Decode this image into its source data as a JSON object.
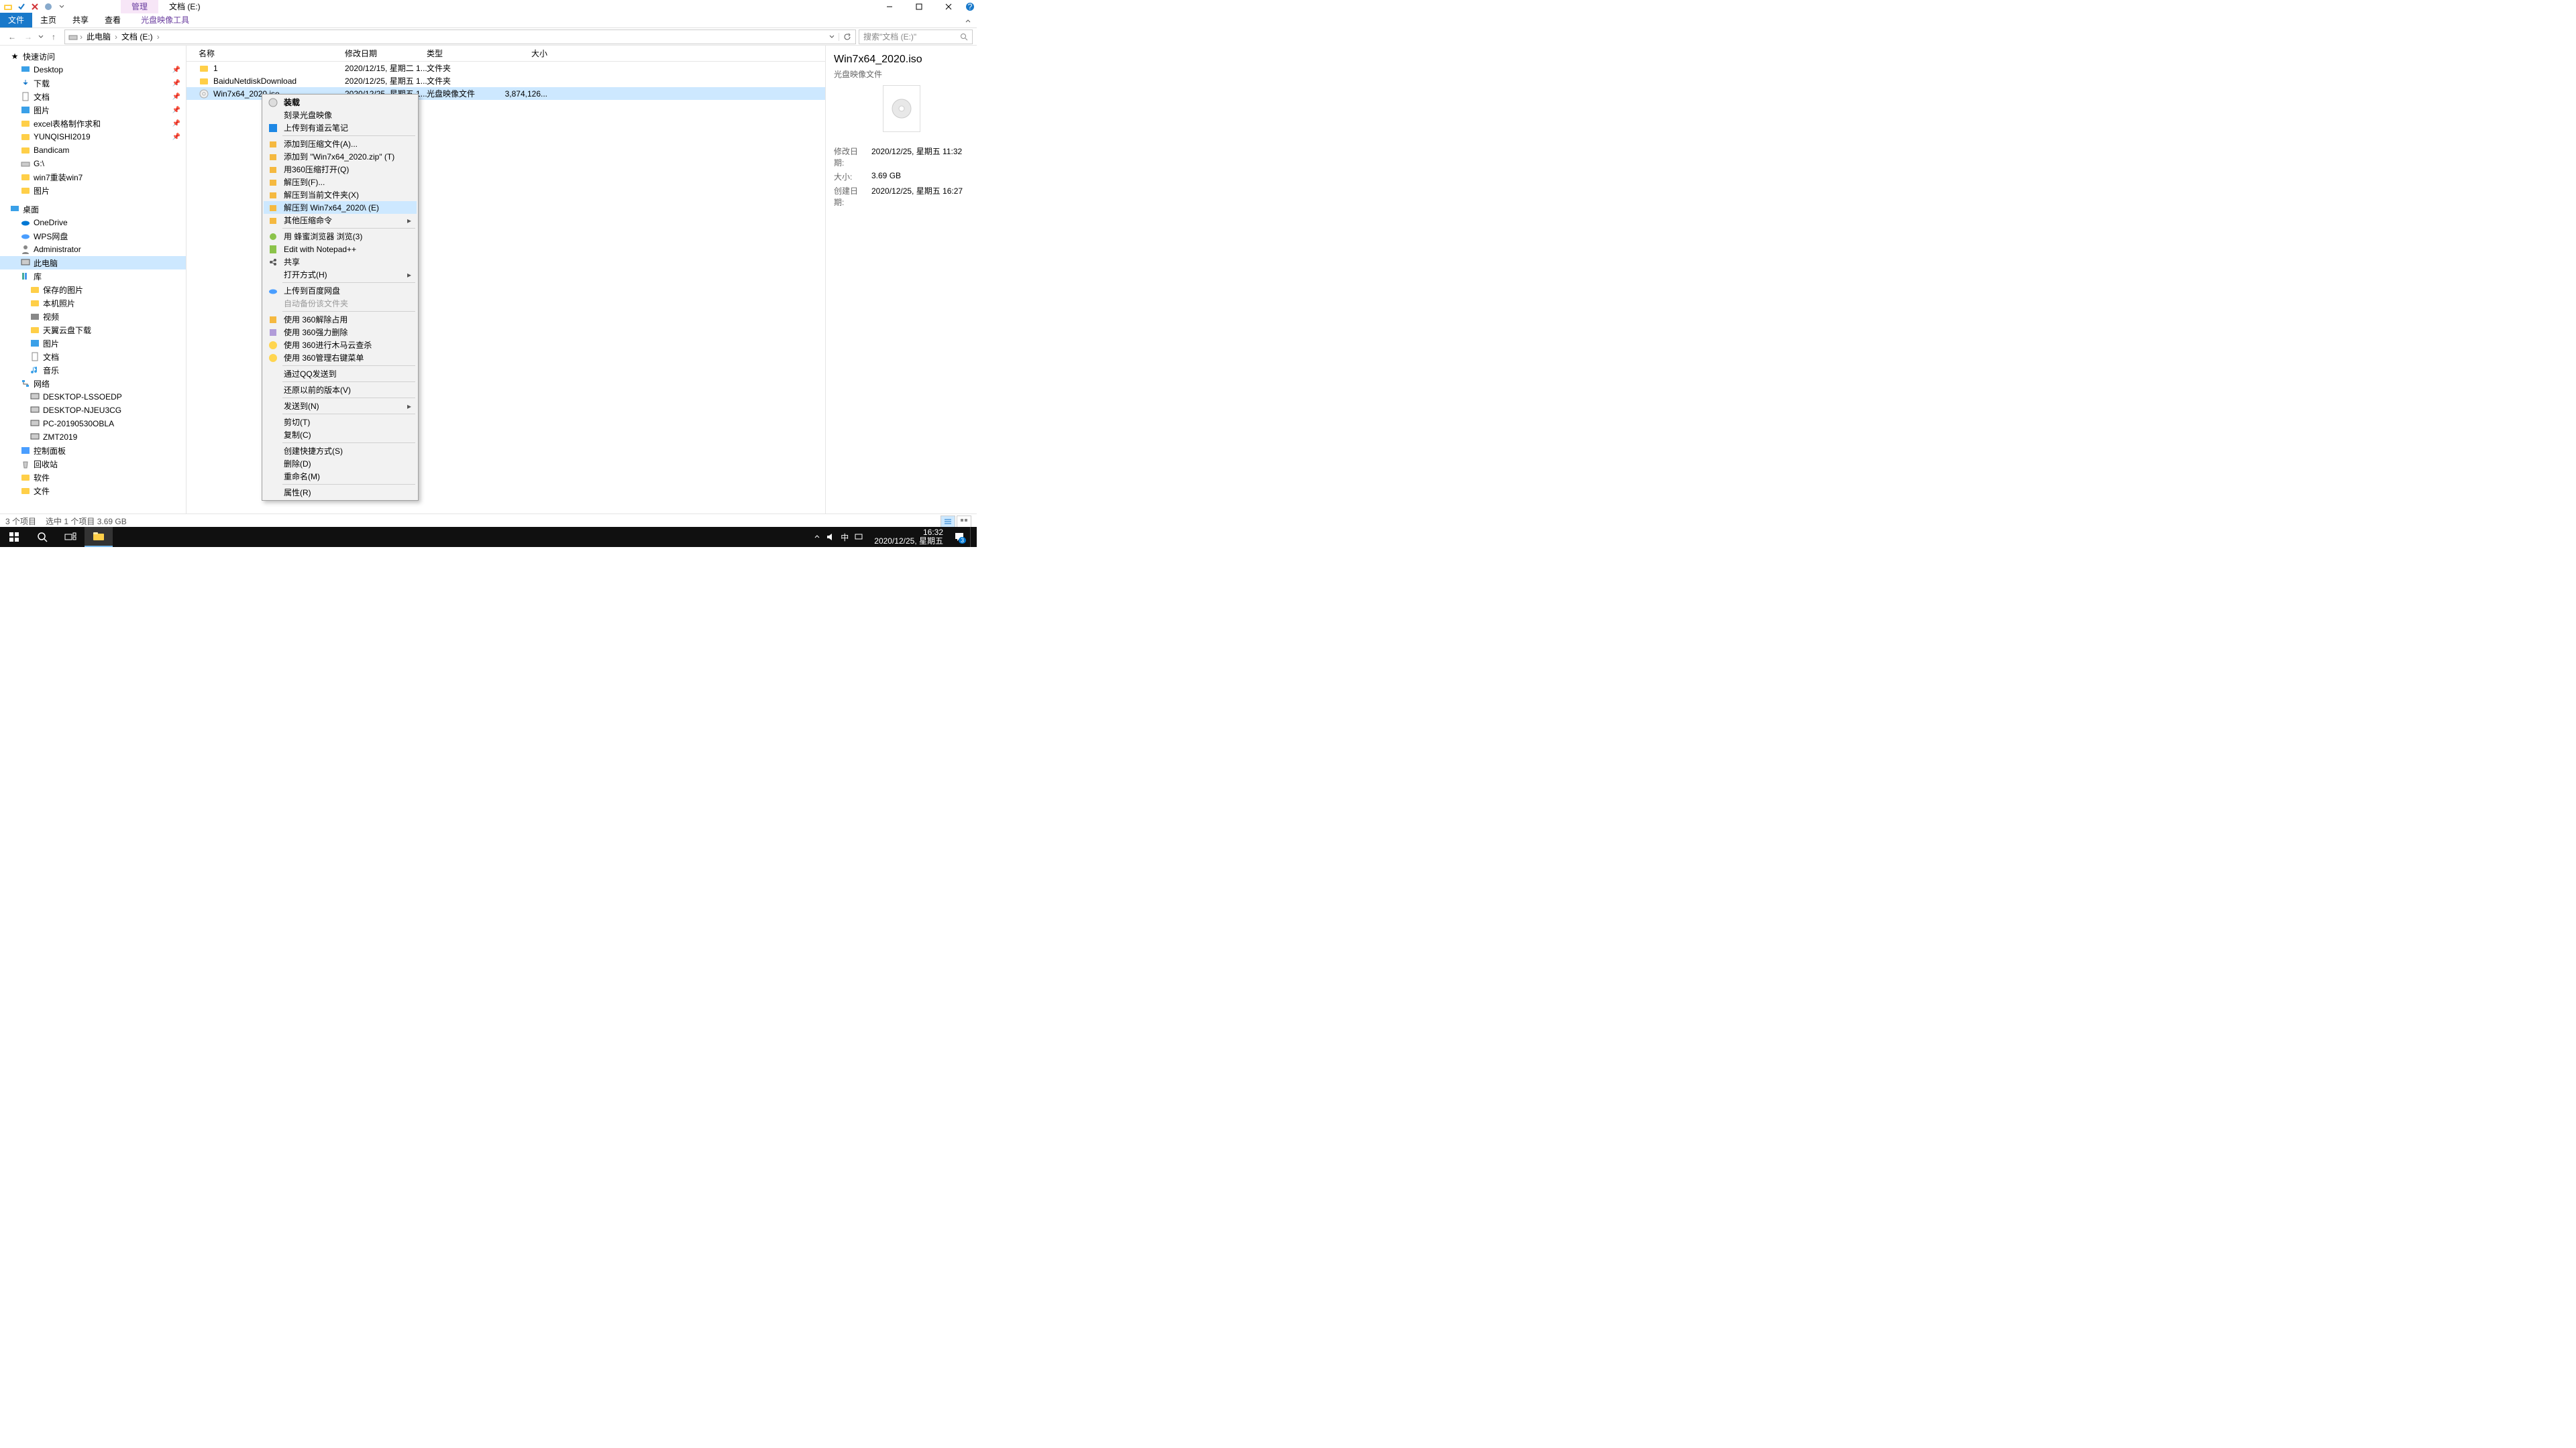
{
  "title_tabs": {
    "manage": "管理",
    "drive": "文档 (E:)"
  },
  "ribbon": {
    "file": "文件",
    "home": "主页",
    "share": "共享",
    "view": "查看",
    "iso_tool": "光盘映像工具"
  },
  "addr": {
    "pc": "此电脑",
    "drive": "文档 (E:)"
  },
  "search_placeholder": "搜索\"文档 (E:)\"",
  "cols": {
    "name": "名称",
    "date": "修改日期",
    "type": "类型",
    "size": "大小"
  },
  "nav": {
    "quick": "快速访问",
    "desktop": "Desktop",
    "downloads": "下载",
    "docs": "文档",
    "pics": "图片",
    "excel": "excel表格制作求和",
    "yunqishi": "YUNQISHI2019",
    "bandicam": "Bandicam",
    "g": "G:\\",
    "win7reinstall": "win7重装win7",
    "pics2": "图片",
    "desktop_root": "桌面",
    "onedrive": "OneDrive",
    "wps": "WPS网盘",
    "admin": "Administrator",
    "thispc": "此电脑",
    "lib": "库",
    "saved_pics": "保存的图片",
    "local_pics": "本机照片",
    "videos": "视频",
    "sky": "天翼云盘下载",
    "pics3": "图片",
    "docs2": "文档",
    "music": "音乐",
    "network": "网络",
    "pc1": "DESKTOP-LSSOEDP",
    "pc2": "DESKTOP-NJEU3CG",
    "pc3": "PC-20190530OBLA",
    "pc4": "ZMT2019",
    "ctrlpanel": "控制面板",
    "recycle": "回收站",
    "soft": "软件",
    "files": "文件"
  },
  "rows": [
    {
      "name": "1",
      "date": "2020/12/15, 星期二 1...",
      "type": "文件夹",
      "size": ""
    },
    {
      "name": "BaiduNetdiskDownload",
      "date": "2020/12/25, 星期五 1...",
      "type": "文件夹",
      "size": ""
    },
    {
      "name": "Win7x64_2020.iso",
      "date": "2020/12/25, 星期五 1...",
      "type": "光盘映像文件",
      "size": "3,874,126..."
    }
  ],
  "ctx": {
    "mount": "装载",
    "burn": "刻录光盘映像",
    "youdao": "上传到有道云笔记",
    "addarchive": "添加到压缩文件(A)...",
    "addzip": "添加到 \"Win7x64_2020.zip\" (T)",
    "open360zip": "用360压缩打开(Q)",
    "extract": "解压到(F)...",
    "extract_here": "解压到当前文件夹(X)",
    "extract_named": "解压到 Win7x64_2020\\ (E)",
    "other_zip": "其他压缩命令",
    "bee": "用 蜂蜜浏览器 浏览(3)",
    "npp": "Edit with Notepad++",
    "share": "共享",
    "openwith": "打开方式(H)",
    "baidu": "上传到百度网盘",
    "autobk": "自动备份该文件夹",
    "t360a": "使用 360解除占用",
    "t360b": "使用 360强力删除",
    "t360c": "使用 360进行木马云查杀",
    "t360d": "使用 360管理右键菜单",
    "qq": "通过QQ发送到",
    "restore": "还原以前的版本(V)",
    "sendto": "发送到(N)",
    "cut": "剪切(T)",
    "copy": "复制(C)",
    "shortcut": "创建快捷方式(S)",
    "del": "删除(D)",
    "rename": "重命名(M)",
    "props": "属性(R)"
  },
  "details": {
    "title": "Win7x64_2020.iso",
    "subtitle": "光盘映像文件",
    "mdate_lbl": "修改日期:",
    "mdate": "2020/12/25, 星期五 11:32",
    "size_lbl": "大小:",
    "size": "3.69 GB",
    "cdate_lbl": "创建日期:",
    "cdate": "2020/12/25, 星期五 16:27"
  },
  "status": {
    "items": "3 个项目",
    "sel": "选中 1 个项目  3.69 GB"
  },
  "tray": {
    "ime": "中",
    "time": "16:32",
    "date": "2020/12/25, 星期五",
    "badge": "3"
  }
}
